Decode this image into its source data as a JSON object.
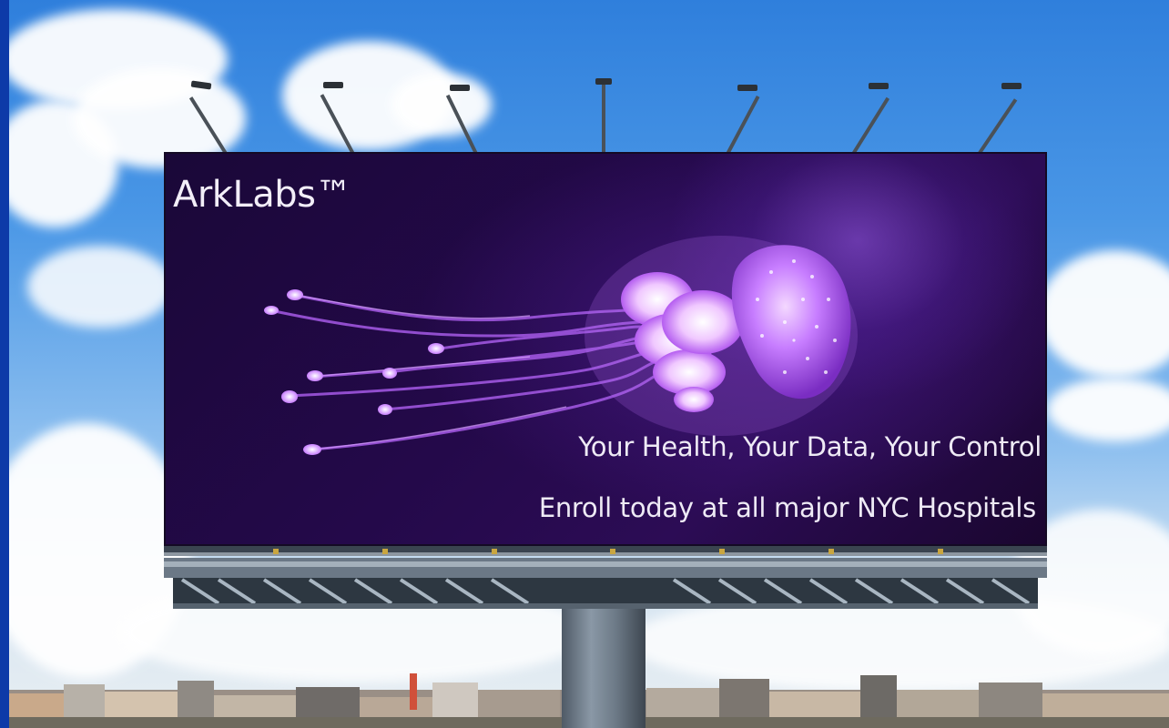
{
  "billboard": {
    "brand": "ArkLabs™",
    "tagline": "Your Health, Your Data, Your Control",
    "call_to_action": "Enroll today at all major NYC Hospitals"
  },
  "colors": {
    "sky": "#3b8ae0",
    "board_background": "#24094a",
    "jellyfish": "#c77dff",
    "text": "#eeeaf5",
    "border": "#0d3aa8"
  },
  "icons": [
    "jellyfish-image",
    "flood-lamp"
  ]
}
